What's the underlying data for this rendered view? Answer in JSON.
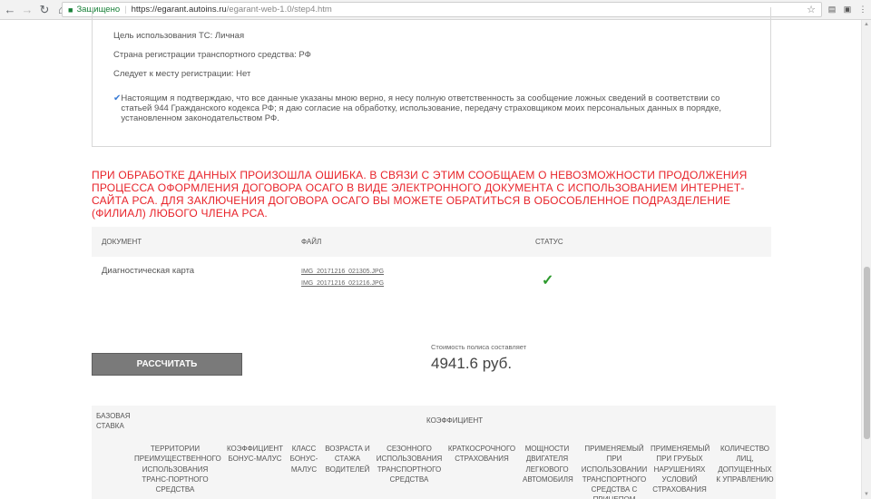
{
  "browser": {
    "secure_label": "Защищено",
    "url_host": "https://egarant.autoins.ru",
    "url_path": "/egarant-web-1.0/step4.htm"
  },
  "summary": {
    "usage_purpose": "Цель использования ТС: Личная",
    "registration_country": "Страна регистрации транспортного средства: РФ",
    "follows_to_registration": "Следует к месту регистрации: Нет",
    "consent_text": "Настоящим я подтверждаю, что все данные указаны мною верно, я несу полную ответственность за сообщение ложных сведений в соответствии со статьей 944 Гражданского кодекса РФ; я даю согласие на обработку, использование, передачу страховщиком моих персональных данных в порядке, установленном законодательством РФ.",
    "consent_checked": true
  },
  "error_message": "ПРИ ОБРАБОТКЕ ДАННЫХ ПРОИЗОШЛА ОШИБКА. В СВЯЗИ С ЭТИМ СООБЩАЕМ О НЕВОЗМОЖНОСТИ ПРОДОЛЖЕНИЯ ПРОЦЕССА ОФОРМЛЕНИЯ ДОГОВОРА ОСАГО В ВИДЕ ЭЛЕКТРОННОГО ДОКУМЕНТА С ИСПОЛЬЗОВАНИЕМ ИНТЕРНЕТ-САЙТА РСА. ДЛЯ ЗАКЛЮЧЕНИЯ ДОГОВОРА ОСАГО ВЫ МОЖЕТЕ ОБРАТИТЬСЯ В ОБОСОБЛЕННОЕ ПОДРАЗДЕЛЕНИЕ (ФИЛИАЛ) ЛЮБОГО ЧЛЕНА РСА.",
  "documents": {
    "headers": [
      "ДОКУМЕНТ",
      "ФАЙЛ",
      "СТАТУС"
    ],
    "rows": [
      {
        "name": "Диагностическая карта",
        "files": [
          "IMG_20171216_021305.JPG",
          "IMG_20171216_021216.JPG"
        ],
        "status": "ok"
      }
    ]
  },
  "calculate_button": "РАССЧИТАТЬ",
  "cost_label": "Стоимость полиса составляет",
  "cost_value": "4941.6 руб.",
  "coefficients": {
    "base_rate": "БАЗОВАЯ СТАВКА",
    "title": "КОЭФФИЦИЕНТ",
    "columns": [
      "ТЕРРИТОРИИ ПРЕИМУЩЕСТВЕННОГО ИСПОЛЬЗОВАНИЯ ТРАНС-ПОРТНОГО СРЕДСТВА",
      "КОЭФФИЦИЕНТ БОНУС-МАЛУС",
      "КЛАСС БОНУС-МАЛУС",
      "ВОЗРАСТА И СТАЖА ВОДИТЕЛЕЙ",
      "СЕЗОННОГО ИСПОЛЬЗОВАНИЯ ТРАНСПОРТНОГО СРЕДСТВА",
      "КРАТКОСРОЧНОГО СТРАХОВАНИЯ",
      "МОЩНОСТИ ДВИГАТЕЛЯ ЛЕГКОВОГО АВТОМОБИЛЯ",
      "ПРИМЕНЯЕМЫЙ ПРИ ИСПОЛЬЗОВАНИИ ТРАНСПОРТНОГО СРЕДСТВА С ПРИЦЕПОМ",
      "ПРИМЕНЯЕМЫЙ ПРИ ГРУБЫХ НАРУШЕНИЯХ УСЛОВИЙ СТРАХОВАНИЯ",
      "КОЛИЧЕСТВО ЛИЦ, ДОПУЩЕННЫХ К УПРАВЛЕНИЮ"
    ]
  },
  "colors": {
    "error": "#e8232a",
    "check": "#2c9a2c",
    "button": "#7a7a7a"
  }
}
